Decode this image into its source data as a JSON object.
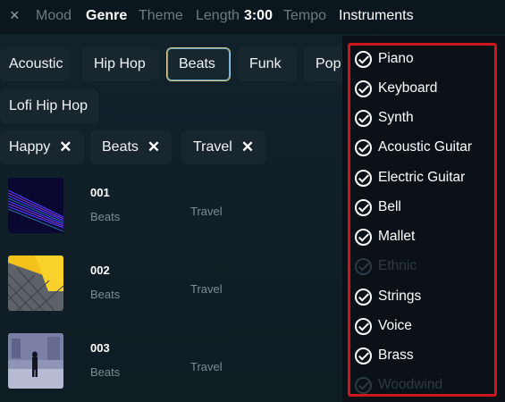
{
  "top_nav": {
    "close_icon": "×",
    "mood": "Mood",
    "genre": "Genre",
    "theme": "Theme",
    "length_label": "Length",
    "length_value": "3:00",
    "tempo": "Tempo",
    "instruments": "Instruments"
  },
  "genre_chips": [
    {
      "label": "Acoustic",
      "selected": false
    },
    {
      "label": "Hip Hop",
      "selected": false
    },
    {
      "label": "Beats",
      "selected": true
    },
    {
      "label": "Funk",
      "selected": false
    },
    {
      "label": "Pop",
      "selected": false
    },
    {
      "label": "Lofi Hip Hop",
      "selected": false
    }
  ],
  "active_tags": [
    {
      "label": "Happy",
      "remove": "✕"
    },
    {
      "label": "Beats",
      "remove": "✕"
    },
    {
      "label": "Travel",
      "remove": "✕"
    }
  ],
  "tracks": [
    {
      "number": "001",
      "genre": "Beats",
      "theme": "Travel",
      "thumbnail": "blue-light-streaks"
    },
    {
      "number": "002",
      "genre": "Beats",
      "theme": "Travel",
      "thumbnail": "yellow-paving"
    },
    {
      "number": "003",
      "genre": "Beats",
      "theme": "Travel",
      "thumbnail": "person-snowy-city"
    }
  ],
  "instruments_dropdown": {
    "items": [
      {
        "label": "Piano",
        "checked": true,
        "enabled": true
      },
      {
        "label": "Keyboard",
        "checked": true,
        "enabled": true
      },
      {
        "label": "Synth",
        "checked": true,
        "enabled": true
      },
      {
        "label": "Acoustic Guitar",
        "checked": true,
        "enabled": true
      },
      {
        "label": "Electric Guitar",
        "checked": true,
        "enabled": true
      },
      {
        "label": "Bell",
        "checked": true,
        "enabled": true
      },
      {
        "label": "Mallet",
        "checked": true,
        "enabled": true
      },
      {
        "label": "Ethnic",
        "checked": true,
        "enabled": false
      },
      {
        "label": "Strings",
        "checked": true,
        "enabled": true
      },
      {
        "label": "Voice",
        "checked": true,
        "enabled": true
      },
      {
        "label": "Brass",
        "checked": true,
        "enabled": true
      },
      {
        "label": "Woodwind",
        "checked": true,
        "enabled": false
      }
    ],
    "highlight_color": "#d0161d"
  }
}
